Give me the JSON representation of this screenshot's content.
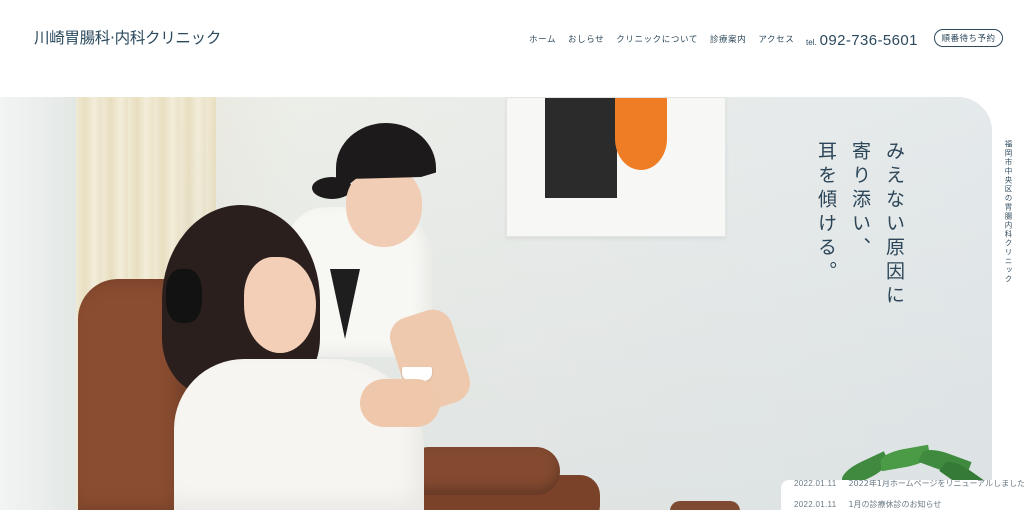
{
  "header": {
    "logo_text": "川崎胃腸科·内科クリニック",
    "nav": [
      "ホーム",
      "おしらせ",
      "クリニックについて",
      "診療案内",
      "アクセス"
    ],
    "tel_prefix": "tel.",
    "tel_number": "092-736-5601",
    "reserve_label": "順番待ち予約"
  },
  "hero": {
    "tagline_lines": [
      "みえない原因に",
      "寄り添い、",
      "耳を傾ける。"
    ],
    "side_caption": "福岡市中央区の胃腸内科クリニック",
    "colors": {
      "accent_orange": "#ef7d25",
      "text_navy": "#2c4557",
      "chair_brown": "#8b4d31"
    }
  },
  "news": [
    {
      "date": "2022.01.11",
      "title": "2022年1月ホームページをリニューアルしました"
    },
    {
      "date": "2022.01.11",
      "title": "1月の診療休診のお知らせ"
    }
  ]
}
